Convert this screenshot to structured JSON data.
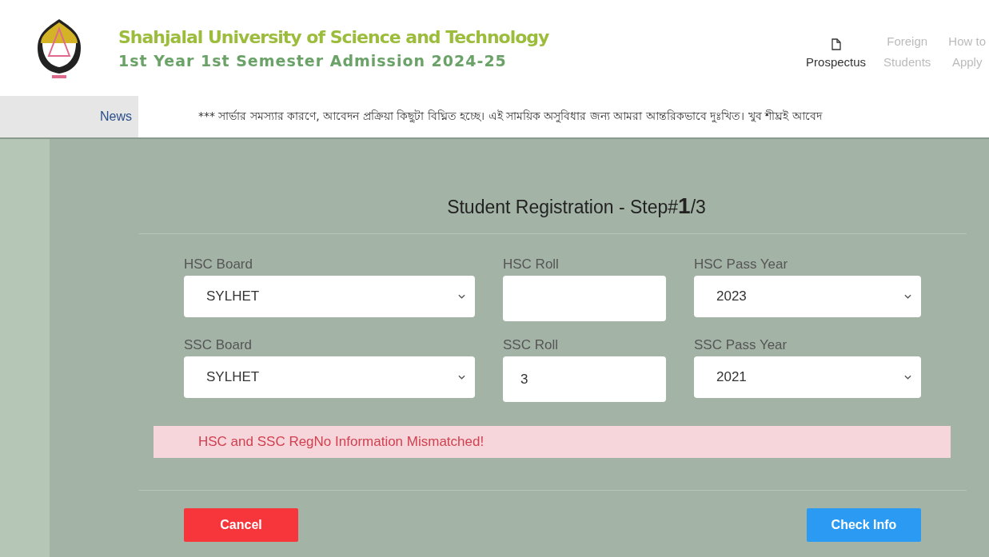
{
  "header": {
    "title": "Shahjalal University of Science and Technology",
    "subtitle": "1st Year 1st Semester Admission 2024-25",
    "nav": [
      {
        "label": "Prospectus",
        "selected": true
      },
      {
        "label": "Foreign",
        "line2": "Students",
        "selected": false
      },
      {
        "label": "How to",
        "line2": "Apply",
        "selected": false
      }
    ]
  },
  "news": {
    "label": "News",
    "text": "*** সার্ভার সমস্যার কারণে, আবেদন প্রক্রিয়া কিছুটা বিঘ্নিত হচ্ছে। এই সাময়িক অসুবিধার জন্য আমরা আন্তরিকভাবে দুঃখিত। খুব শীঘ্রই আবেদ"
  },
  "form": {
    "title": "Student Registration - Step#**1**/3",
    "fields": [
      {
        "label": "HSC Board",
        "kind": "select",
        "value": "SYLHET"
      },
      {
        "label": "HSC Roll",
        "kind": "input"
      },
      {
        "label": "HSC Pass Year",
        "kind": "select",
        "value": "2023"
      },
      {
        "label": "SSC Board",
        "kind": "select",
        "value": "SYLHET"
      },
      {
        "label": "SSC Roll",
        "kind": "input",
        "value": "3"
      },
      {
        "label": "SSC Pass Year",
        "kind": "select",
        "value": "2021"
      }
    ],
    "error": "HSC and SSC RegNo Information Mismatched!",
    "buttons": [
      {
        "label": "Cancel",
        "kind": "danger"
      },
      {
        "label": "Check Info",
        "kind": "primary"
      }
    ]
  }
}
